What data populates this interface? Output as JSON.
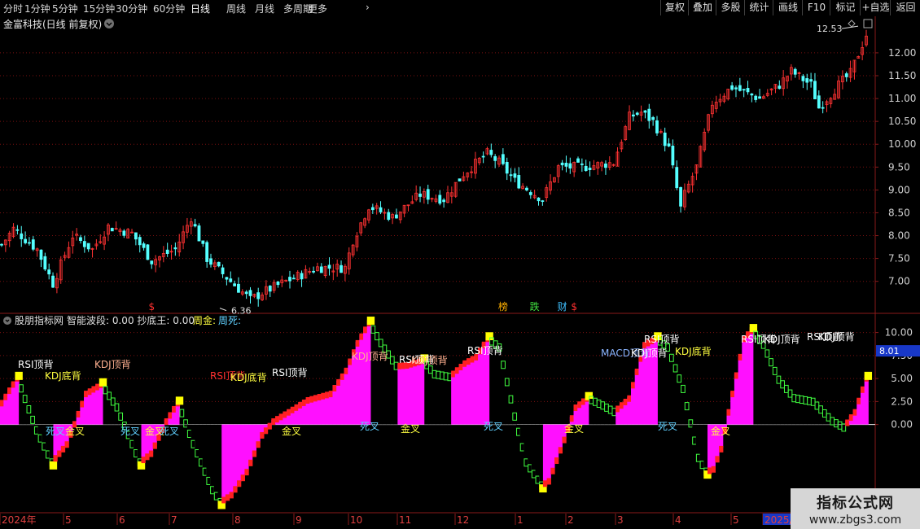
{
  "toolbar": {
    "tabs": [
      "分时",
      "1分钟",
      "5分钟",
      "15分钟",
      "30分钟",
      "60分钟",
      "日线",
      "周线",
      "月线",
      "多周期",
      "更多"
    ],
    "more_chevron": "›",
    "active_tab": "日线",
    "right_buttons": [
      "复权",
      "叠加",
      "多股",
      "统计",
      "画线",
      "F10",
      "标记",
      "+自选",
      "返回"
    ]
  },
  "main_panel": {
    "title": "金富科技(日线 前复权)",
    "ylim": [
      6.3,
      12.8
    ],
    "yticks": [
      "12.00",
      "11.50",
      "11.00",
      "10.50",
      "10.00",
      "9.50",
      "9.00",
      "8.50",
      "8.00",
      "7.50",
      "7.00"
    ],
    "high_label": "12.53",
    "low_label": "6.36",
    "event_markers": [
      {
        "text": "$",
        "x_index": 38,
        "color": "#ff3030"
      },
      {
        "text": "榜",
        "x_index": 127,
        "color": "#ffb000"
      },
      {
        "text": "跌",
        "x_index": 135,
        "color": "#40e040"
      },
      {
        "text": "财",
        "x_index": 142,
        "color": "#40c0ff"
      },
      {
        "text": "$",
        "x_index": 145,
        "color": "#ff3030"
      }
    ]
  },
  "sub_panel": {
    "title": "股朋指标网",
    "indicator_line": "智能波段: 0.00  抄底王: 0.00",
    "legend_gold": "周金:",
    "legend_dead": "周死:",
    "current_value": "8.01",
    "ylim": [
      -9.5,
      12
    ],
    "yticks": [
      "10.00",
      "7.50",
      "5.00",
      "2.50",
      "0.00"
    ],
    "signal_labels": [
      {
        "text": "RSI顶背",
        "x": 22,
        "y": 448,
        "color": "#ffffff"
      },
      {
        "text": "KDJ底背",
        "x": 55,
        "y": 462,
        "color": "#ffff40"
      },
      {
        "text": "KDJ顶背",
        "x": 116,
        "y": 448,
        "color": "#ffb090"
      },
      {
        "text": "RSI顶背",
        "x": 258,
        "y": 462,
        "color": "#ff3030"
      },
      {
        "text": "KDJ底背",
        "x": 283,
        "y": 464,
        "color": "#ffff40"
      },
      {
        "text": "RSI顶背",
        "x": 334,
        "y": 458,
        "color": "#ffffff"
      },
      {
        "text": "KDJ顶背",
        "x": 432,
        "y": 438,
        "color": "#ffb090"
      },
      {
        "text": "RSI顶背",
        "x": 490,
        "y": 442,
        "color": "#ffffff"
      },
      {
        "text": "KDJ顶背",
        "x": 505,
        "y": 443,
        "color": "#ffb090"
      },
      {
        "text": "RSI顶背",
        "x": 574,
        "y": 431,
        "color": "#ffffff"
      },
      {
        "text": "MACD顶背",
        "x": 738,
        "y": 434,
        "color": "#8ab4ff"
      },
      {
        "text": "KDJ顶背",
        "x": 775,
        "y": 434,
        "color": "#ffffff"
      },
      {
        "text": "RSI顶背",
        "x": 791,
        "y": 417,
        "color": "#ffffff"
      },
      {
        "text": "KDJ底背",
        "x": 829,
        "y": 432,
        "color": "#ffff40"
      },
      {
        "text": "RSI顶背",
        "x": 910,
        "y": 417,
        "color": "#ffffff"
      },
      {
        "text": "KDJ顶背",
        "x": 938,
        "y": 417,
        "color": "#ffffff"
      },
      {
        "text": "RSI顶背",
        "x": 991,
        "y": 414,
        "color": "#ffffff"
      },
      {
        "text": "KDJ顶背",
        "x": 1005,
        "y": 414,
        "color": "#ffffff"
      },
      {
        "text": "死叉",
        "x": 56,
        "y": 530,
        "color": "#60d0ff"
      },
      {
        "text": "金叉",
        "x": 80,
        "y": 530,
        "color": "#ffff40"
      },
      {
        "text": "死叉",
        "x": 148,
        "y": 530,
        "color": "#60d0ff"
      },
      {
        "text": "金叉",
        "x": 178,
        "y": 530,
        "color": "#ffff40"
      },
      {
        "text": "死叉",
        "x": 196,
        "y": 530,
        "color": "#60d0ff"
      },
      {
        "text": "金叉",
        "x": 346,
        "y": 530,
        "color": "#ffff40"
      },
      {
        "text": "死叉",
        "x": 442,
        "y": 524,
        "color": "#60d0ff"
      },
      {
        "text": "金叉",
        "x": 492,
        "y": 527,
        "color": "#ffff40"
      },
      {
        "text": "死叉",
        "x": 594,
        "y": 524,
        "color": "#60d0ff"
      },
      {
        "text": "金叉",
        "x": 693,
        "y": 527,
        "color": "#ffff40"
      },
      {
        "text": "死叉",
        "x": 808,
        "y": 524,
        "color": "#60d0ff"
      },
      {
        "text": "金叉",
        "x": 873,
        "y": 530,
        "color": "#ffff40"
      }
    ]
  },
  "time_axis": {
    "labels": [
      {
        "text": "2024年",
        "x": 2
      },
      {
        "text": "5",
        "x": 80
      },
      {
        "text": "6",
        "x": 146
      },
      {
        "text": "7",
        "x": 210
      },
      {
        "text": "8",
        "x": 288
      },
      {
        "text": "9",
        "x": 363
      },
      {
        "text": "10",
        "x": 430
      },
      {
        "text": "11",
        "x": 490
      },
      {
        "text": "12",
        "x": 561
      },
      {
        "text": "1",
        "x": 635
      },
      {
        "text": "2",
        "x": 697
      },
      {
        "text": "3",
        "x": 758
      },
      {
        "text": "4",
        "x": 829
      },
      {
        "text": "5",
        "x": 900
      },
      {
        "text": "2025/",
        "x": 939
      }
    ]
  },
  "watermark": {
    "line1": "指标公式网",
    "line2": "www.zbgs3.com"
  },
  "colors": {
    "up": "#ff3232",
    "down": "#54ffff",
    "grid": "#7a1010",
    "wave_up": "#ff10ff",
    "wave_red": "#ff2020",
    "wave_green": "#40ff40",
    "peak": "#ffff00"
  },
  "chart_data": [
    {
      "type": "candlestick",
      "title": "金富科技(日线 前复权)",
      "ylim": [
        6.3,
        12.8
      ],
      "keypoints": [
        [
          0,
          7.8
        ],
        [
          3,
          8.15
        ],
        [
          9,
          7.7
        ],
        [
          13,
          6.95
        ],
        [
          18,
          8.0
        ],
        [
          23,
          7.7
        ],
        [
          27,
          8.2
        ],
        [
          33,
          8.05
        ],
        [
          38,
          7.45
        ],
        [
          44,
          7.7
        ],
        [
          48,
          8.4
        ],
        [
          52,
          7.5
        ],
        [
          58,
          7.0
        ],
        [
          63,
          6.6
        ],
        [
          66,
          6.75
        ],
        [
          72,
          7.0
        ],
        [
          80,
          7.3
        ],
        [
          87,
          7.3
        ],
        [
          89,
          7.9
        ],
        [
          93,
          8.65
        ],
        [
          99,
          8.4
        ],
        [
          106,
          8.9
        ],
        [
          112,
          8.8
        ],
        [
          117,
          9.35
        ],
        [
          123,
          9.8
        ],
        [
          126,
          9.6
        ],
        [
          130,
          9.2
        ],
        [
          137,
          8.8
        ],
        [
          141,
          9.5
        ],
        [
          147,
          9.5
        ],
        [
          155,
          9.6
        ],
        [
          159,
          10.6
        ],
        [
          162,
          10.7
        ],
        [
          165,
          10.5
        ],
        [
          169,
          9.9
        ],
        [
          172,
          8.6
        ],
        [
          173,
          8.9
        ],
        [
          176,
          9.5
        ],
        [
          180,
          10.9
        ],
        [
          185,
          11.25
        ],
        [
          192,
          11.0
        ],
        [
          197,
          11.3
        ],
        [
          200,
          11.6
        ],
        [
          205,
          11.3
        ],
        [
          207,
          10.8
        ],
        [
          212,
          11.3
        ],
        [
          215,
          11.55
        ],
        [
          219,
          12.4
        ]
      ],
      "n": 220,
      "high_low_marks": {
        "high": 12.53,
        "low": 6.36
      }
    },
    {
      "type": "area",
      "title": "股朋指标网",
      "ylim": [
        -9.5,
        12
      ],
      "keypoints": [
        [
          0,
          2.5
        ],
        [
          4,
          5.2
        ],
        [
          9,
          -0.5
        ],
        [
          13,
          -4
        ],
        [
          17,
          -2
        ],
        [
          22,
          3.5
        ],
        [
          26,
          4.5
        ],
        [
          30,
          2
        ],
        [
          33,
          -1
        ],
        [
          36,
          -4
        ],
        [
          39,
          -3
        ],
        [
          43,
          0.5
        ],
        [
          46,
          2.5
        ],
        [
          50,
          -2
        ],
        [
          55,
          -7
        ],
        [
          57,
          -8.3
        ],
        [
          60,
          -7.5
        ],
        [
          64,
          -5
        ],
        [
          68,
          -1
        ],
        [
          71,
          0.5
        ],
        [
          75,
          1.5
        ],
        [
          80,
          2.8
        ],
        [
          86,
          3.5
        ],
        [
          90,
          6
        ],
        [
          93,
          9
        ],
        [
          96,
          11.2
        ],
        [
          99,
          9
        ],
        [
          103,
          6.5
        ],
        [
          106,
          6.6
        ],
        [
          110,
          7.1
        ],
        [
          113,
          5.6
        ],
        [
          117,
          5.3
        ],
        [
          121,
          6.8
        ],
        [
          124,
          7.5
        ],
        [
          127,
          9.5
        ],
        [
          130,
          8.5
        ],
        [
          134,
          1
        ],
        [
          137,
          -4
        ],
        [
          141,
          -6.5
        ],
        [
          143,
          -6
        ],
        [
          147,
          -1.5
        ],
        [
          150,
          2
        ],
        [
          153,
          3
        ],
        [
          157,
          2.2
        ],
        [
          160,
          1.5
        ],
        [
          164,
          3
        ],
        [
          168,
          8.8
        ],
        [
          171,
          9.5
        ],
        [
          174,
          8.5
        ],
        [
          178,
          4
        ],
        [
          182,
          -3.5
        ],
        [
          184,
          -5
        ],
        [
          186,
          -4.7
        ],
        [
          188,
          -2.5
        ],
        [
          191,
          3.5
        ],
        [
          194,
          9.5
        ],
        [
          196,
          10.4
        ],
        [
          199,
          8.8
        ],
        [
          203,
          5
        ],
        [
          207,
          3
        ],
        [
          212,
          2.6
        ],
        [
          217,
          0.5
        ],
        [
          220,
          -0.2
        ],
        [
          223,
          1.5
        ],
        [
          226,
          5.2
        ]
      ],
      "n": 227,
      "series": [
        {
          "name": "周金"
        },
        {
          "name": "周死"
        }
      ],
      "current_value": 8.01
    }
  ]
}
